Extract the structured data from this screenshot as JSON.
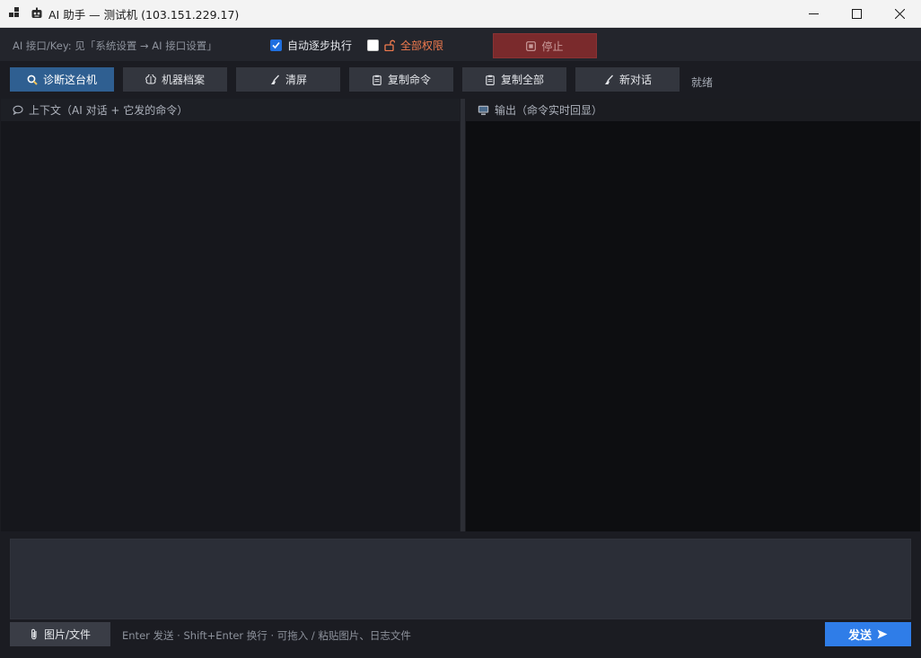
{
  "window": {
    "title": "AI 助手 — 测试机 (103.151.229.17)"
  },
  "options": {
    "api_hint": "AI 接口/Key: 见「系统设置 → AI 接口设置」",
    "auto_step_label": "自动逐步执行",
    "auto_step_checked": true,
    "full_perm_label": "全部权限",
    "full_perm_checked": false,
    "stop_label": "停止"
  },
  "toolbar": {
    "diagnose_label": "诊断这台机",
    "profile_label": "机器档案",
    "clear_label": "清屏",
    "copy_cmd_label": "复制命令",
    "copy_all_label": "复制全部",
    "new_chat_label": "新对话",
    "status": "就绪"
  },
  "panes": {
    "context_title": "上下文（AI 对话 + 它发的命令）",
    "output_title": "输出（命令实时回显）"
  },
  "composer": {
    "attach_label": "图片/文件",
    "hint": "Enter 发送 · Shift+Enter 换行 · 可拖入 / 粘贴图片、日志文件",
    "send_label": "发送"
  },
  "colors": {
    "accent": "#2f7de8",
    "primary_button": "#2f5f91",
    "stop_button": "#7a2a2c",
    "warning_text": "#f07a4e"
  }
}
